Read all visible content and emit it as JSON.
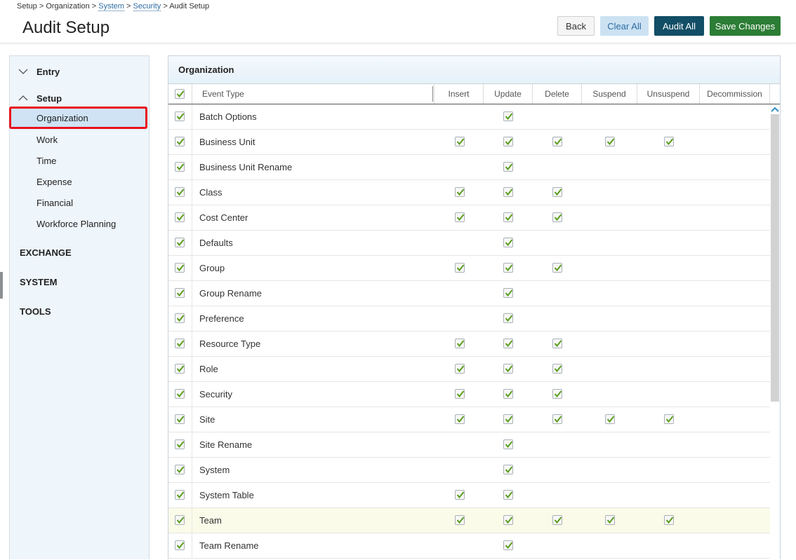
{
  "breadcrumb": {
    "items": [
      "Setup",
      "Organization",
      "System",
      "Security",
      "Audit Setup"
    ],
    "separator": ">"
  },
  "header": {
    "title": "Audit Setup",
    "back_label": "Back",
    "clear_label": "Clear All",
    "audit_label": "Audit All",
    "save_label": "Save Changes"
  },
  "sidebar": {
    "entry_label": "Entry",
    "setup_label": "Setup",
    "items": [
      "Organization",
      "Work",
      "Time",
      "Expense",
      "Financial",
      "Workforce Planning"
    ],
    "active_item": "Organization",
    "exchange_label": "EXCHANGE",
    "system_label": "SYSTEM",
    "tools_label": "TOOLS"
  },
  "panel": {
    "title": "Organization",
    "columns": [
      "Event Type",
      "Insert",
      "Update",
      "Delete",
      "Suspend",
      "Unsuspend",
      "Decommission"
    ]
  },
  "rows": [
    {
      "name": "Batch Options",
      "checks": [
        false,
        true,
        false,
        false,
        false,
        false
      ]
    },
    {
      "name": "Business Unit",
      "checks": [
        true,
        true,
        true,
        true,
        true,
        false
      ]
    },
    {
      "name": "Business Unit Rename",
      "checks": [
        false,
        true,
        false,
        false,
        false,
        false
      ]
    },
    {
      "name": "Class",
      "checks": [
        true,
        true,
        true,
        false,
        false,
        false
      ]
    },
    {
      "name": "Cost Center",
      "checks": [
        true,
        true,
        true,
        false,
        false,
        false
      ]
    },
    {
      "name": "Defaults",
      "checks": [
        false,
        true,
        false,
        false,
        false,
        false
      ]
    },
    {
      "name": "Group",
      "checks": [
        true,
        true,
        true,
        false,
        false,
        false
      ]
    },
    {
      "name": "Group Rename",
      "checks": [
        false,
        true,
        false,
        false,
        false,
        false
      ]
    },
    {
      "name": "Preference",
      "checks": [
        false,
        true,
        false,
        false,
        false,
        false
      ]
    },
    {
      "name": "Resource Type",
      "checks": [
        true,
        true,
        true,
        false,
        false,
        false
      ]
    },
    {
      "name": "Role",
      "checks": [
        true,
        true,
        true,
        false,
        false,
        false
      ]
    },
    {
      "name": "Security",
      "checks": [
        true,
        true,
        true,
        false,
        false,
        false
      ]
    },
    {
      "name": "Site",
      "checks": [
        true,
        true,
        true,
        true,
        true,
        false
      ]
    },
    {
      "name": "Site Rename",
      "checks": [
        false,
        true,
        false,
        false,
        false,
        false
      ]
    },
    {
      "name": "System",
      "checks": [
        false,
        true,
        false,
        false,
        false,
        false
      ]
    },
    {
      "name": "System Table",
      "checks": [
        true,
        true,
        false,
        false,
        false,
        false
      ]
    },
    {
      "name": "Team",
      "checks": [
        true,
        true,
        true,
        true,
        true,
        false
      ],
      "highlight": true
    },
    {
      "name": "Team Rename",
      "checks": [
        false,
        true,
        false,
        false,
        false,
        false
      ]
    }
  ],
  "colors": {
    "check": "#5a9e1e",
    "highlight_row": "#fbfbe9",
    "active_outline": "#e8101c",
    "save_button": "#2c7d35",
    "audit_button": "#124e66"
  }
}
